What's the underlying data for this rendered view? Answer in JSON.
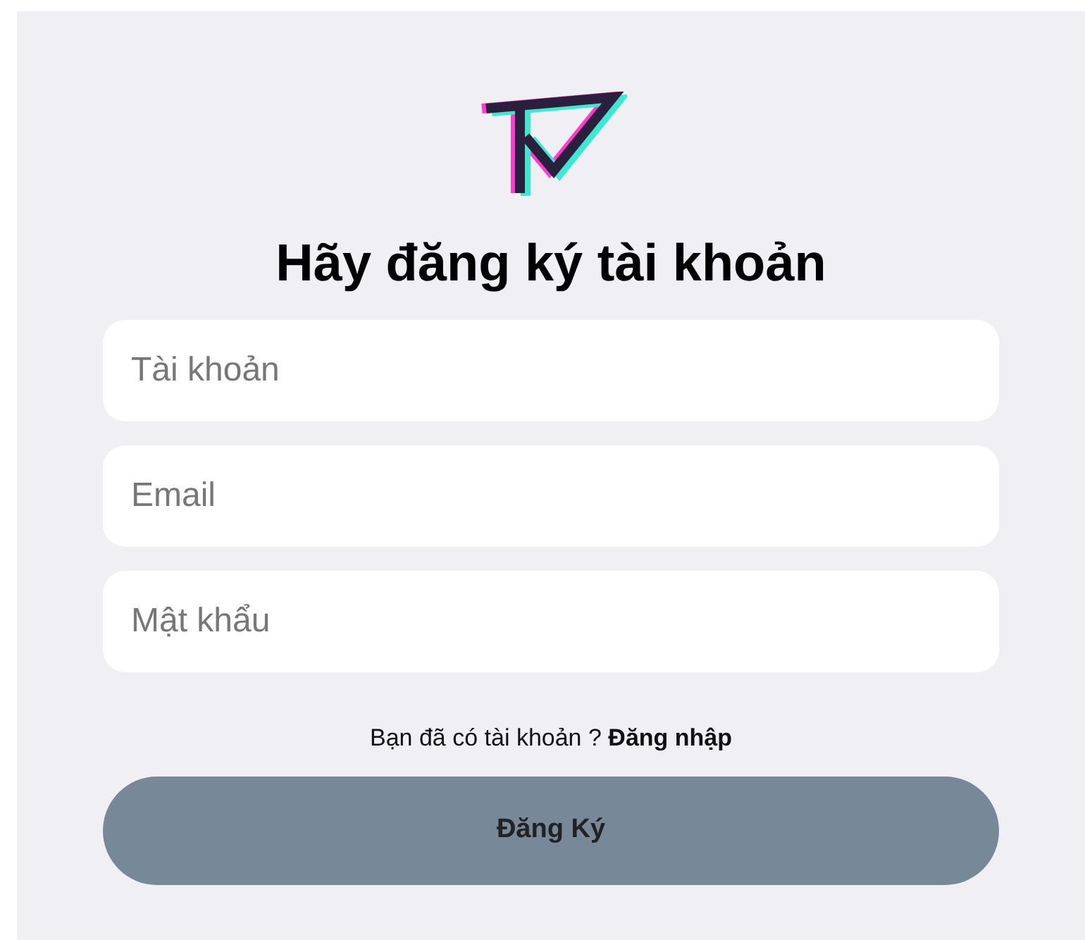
{
  "title": "Hãy đăng ký tài khoản",
  "fields": [
    {
      "placeholder": "Tài khoản"
    },
    {
      "placeholder": "Email"
    },
    {
      "placeholder": "Mật khẩu"
    }
  ],
  "login_prompt": {
    "text": "Bạn đã có tài khoản ?",
    "link": "Đăng nhập"
  },
  "submit_button": "Đăng Ký"
}
